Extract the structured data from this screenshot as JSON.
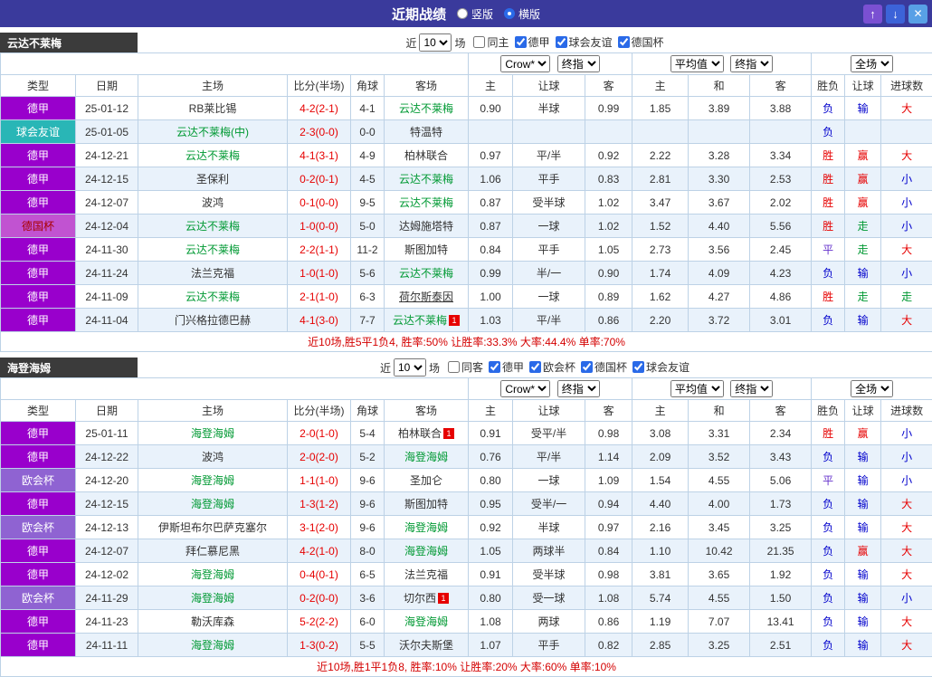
{
  "header": {
    "title": "近期战绩",
    "vertical_label": "竖版",
    "horizontal_label": "横版",
    "selected_layout": "横版",
    "up_icon": "↑",
    "down_icon": "↓",
    "close_icon": "✕"
  },
  "colors": {
    "topbar": "#3a3a9c",
    "focus_team": "#009933",
    "win": "#e60000",
    "lose": "#0000cc",
    "go": "#009933",
    "draw": "#6633cc"
  },
  "columns": [
    "类型",
    "日期",
    "主场",
    "比分(半场)",
    "角球",
    "客场",
    "主",
    "让球",
    "客",
    "主",
    "和",
    "客",
    "胜负",
    "让球",
    "进球数"
  ],
  "sections": [
    {
      "team": "云达不莱梅",
      "filters": {
        "near_label": "近",
        "count": "10",
        "games_label": "场",
        "options": [
          {
            "label": "同主",
            "checked": false
          },
          {
            "label": "德甲",
            "checked": true
          },
          {
            "label": "球会友谊",
            "checked": true
          },
          {
            "label": "德国杯",
            "checked": true
          }
        ]
      },
      "selects": {
        "asia_company": "Crow*",
        "asia_kind": "终指",
        "euro_company": "平均值",
        "euro_kind": "终指",
        "scope": "全场"
      },
      "rows": [
        {
          "type": "德甲",
          "tc": "dj",
          "date": "25-01-12",
          "home": {
            "t": "RB莱比锡"
          },
          "score": "4-2(2-1)",
          "corner": "4-1",
          "away": {
            "t": "云达不莱梅",
            "f": 1
          },
          "odds": [
            "0.90",
            "半球",
            "0.99",
            "1.85",
            "3.89",
            "3.88"
          ],
          "res": {
            "t": "负",
            "c": "b"
          },
          "hcp": {
            "t": "输",
            "c": "b"
          },
          "gl": {
            "t": "大",
            "c": "r"
          }
        },
        {
          "type": "球会友谊",
          "tc": "fr",
          "date": "25-01-05",
          "home": {
            "t": "云达不莱梅(中)",
            "f": 1
          },
          "score": "2-3(0-0)",
          "corner": "0-0",
          "away": {
            "t": "特温特"
          },
          "odds": [
            "",
            "",
            "",
            "",
            "",
            ""
          ],
          "res": {
            "t": "负",
            "c": "b"
          },
          "hcp": {
            "t": "",
            "c": "b"
          },
          "gl": {
            "t": "",
            "c": "r"
          }
        },
        {
          "type": "德甲",
          "tc": "dj",
          "date": "24-12-21",
          "home": {
            "t": "云达不莱梅",
            "f": 1
          },
          "score": "4-1(3-1)",
          "corner": "4-9",
          "away": {
            "t": "柏林联合"
          },
          "odds": [
            "0.97",
            "平/半",
            "0.92",
            "2.22",
            "3.28",
            "3.34"
          ],
          "res": {
            "t": "胜",
            "c": "r"
          },
          "hcp": {
            "t": "赢",
            "c": "r"
          },
          "gl": {
            "t": "大",
            "c": "r"
          }
        },
        {
          "type": "德甲",
          "tc": "dj",
          "date": "24-12-15",
          "home": {
            "t": "圣保利"
          },
          "score": "0-2(0-1)",
          "corner": "4-5",
          "away": {
            "t": "云达不莱梅",
            "f": 1
          },
          "odds": [
            "1.06",
            "平手",
            "0.83",
            "2.81",
            "3.30",
            "2.53"
          ],
          "res": {
            "t": "胜",
            "c": "r"
          },
          "hcp": {
            "t": "赢",
            "c": "r"
          },
          "gl": {
            "t": "小",
            "c": "b"
          }
        },
        {
          "type": "德甲",
          "tc": "dj",
          "date": "24-12-07",
          "home": {
            "t": "波鸿"
          },
          "score": "0-1(0-0)",
          "corner": "9-5",
          "away": {
            "t": "云达不莱梅",
            "f": 1
          },
          "odds": [
            "0.87",
            "受半球",
            "1.02",
            "3.47",
            "3.67",
            "2.02"
          ],
          "res": {
            "t": "胜",
            "c": "r"
          },
          "hcp": {
            "t": "赢",
            "c": "r"
          },
          "gl": {
            "t": "小",
            "c": "b"
          }
        },
        {
          "type": "德国杯",
          "tc": "dc",
          "date": "24-12-04",
          "home": {
            "t": "云达不莱梅",
            "f": 1
          },
          "score": "1-0(0-0)",
          "corner": "5-0",
          "away": {
            "t": "达姆施塔特"
          },
          "odds": [
            "0.87",
            "一球",
            "1.02",
            "1.52",
            "4.40",
            "5.56"
          ],
          "res": {
            "t": "胜",
            "c": "r"
          },
          "hcp": {
            "t": "走",
            "c": "g"
          },
          "gl": {
            "t": "小",
            "c": "b"
          }
        },
        {
          "type": "德甲",
          "tc": "dj",
          "date": "24-11-30",
          "home": {
            "t": "云达不莱梅",
            "f": 1
          },
          "score": "2-2(1-1)",
          "corner": "11-2",
          "away": {
            "t": "斯图加特"
          },
          "odds": [
            "0.84",
            "平手",
            "1.05",
            "2.73",
            "3.56",
            "2.45"
          ],
          "res": {
            "t": "平",
            "c": "p"
          },
          "hcp": {
            "t": "走",
            "c": "g"
          },
          "gl": {
            "t": "大",
            "c": "r"
          }
        },
        {
          "type": "德甲",
          "tc": "dj",
          "date": "24-11-24",
          "home": {
            "t": "法兰克福"
          },
          "score": "1-0(1-0)",
          "corner": "5-6",
          "away": {
            "t": "云达不莱梅",
            "f": 1
          },
          "odds": [
            "0.99",
            "半/一",
            "0.90",
            "1.74",
            "4.09",
            "4.23"
          ],
          "res": {
            "t": "负",
            "c": "b"
          },
          "hcp": {
            "t": "输",
            "c": "b"
          },
          "gl": {
            "t": "小",
            "c": "b"
          }
        },
        {
          "type": "德甲",
          "tc": "dj",
          "date": "24-11-09",
          "home": {
            "t": "云达不莱梅",
            "f": 1
          },
          "score": "2-1(1-0)",
          "corner": "6-3",
          "away": {
            "t": "荷尔斯泰因",
            "u": 1
          },
          "odds": [
            "1.00",
            "一球",
            "0.89",
            "1.62",
            "4.27",
            "4.86"
          ],
          "res": {
            "t": "胜",
            "c": "r"
          },
          "hcp": {
            "t": "走",
            "c": "g"
          },
          "gl": {
            "t": "走",
            "c": "g"
          }
        },
        {
          "type": "德甲",
          "tc": "dj",
          "date": "24-11-04",
          "home": {
            "t": "门兴格拉德巴赫"
          },
          "score": "4-1(3-0)",
          "corner": "7-7",
          "away": {
            "t": "云达不莱梅",
            "f": 1,
            "card": "1"
          },
          "odds": [
            "1.03",
            "平/半",
            "0.86",
            "2.20",
            "3.72",
            "3.01"
          ],
          "res": {
            "t": "负",
            "c": "b"
          },
          "hcp": {
            "t": "输",
            "c": "b"
          },
          "gl": {
            "t": "大",
            "c": "r"
          }
        }
      ],
      "summary": "近10场,胜5平1负4, 胜率:50% 让胜率:33.3% 大率:44.4% 单率:70%"
    },
    {
      "team": "海登海姆",
      "filters": {
        "near_label": "近",
        "count": "10",
        "games_label": "场",
        "options": [
          {
            "label": "同客",
            "checked": false
          },
          {
            "label": "德甲",
            "checked": true
          },
          {
            "label": "欧会杯",
            "checked": true
          },
          {
            "label": "德国杯",
            "checked": true
          },
          {
            "label": "球会友谊",
            "checked": true
          }
        ]
      },
      "selects": {
        "asia_company": "Crow*",
        "asia_kind": "终指",
        "euro_company": "平均值",
        "euro_kind": "终指",
        "scope": "全场"
      },
      "rows": [
        {
          "type": "德甲",
          "tc": "dj",
          "date": "25-01-11",
          "home": {
            "t": "海登海姆",
            "f": 1
          },
          "score": "2-0(1-0)",
          "corner": "5-4",
          "away": {
            "t": "柏林联合",
            "card": "1"
          },
          "odds": [
            "0.91",
            "受平/半",
            "0.98",
            "3.08",
            "3.31",
            "2.34"
          ],
          "res": {
            "t": "胜",
            "c": "r"
          },
          "hcp": {
            "t": "赢",
            "c": "r"
          },
          "gl": {
            "t": "小",
            "c": "b"
          }
        },
        {
          "type": "德甲",
          "tc": "dj",
          "date": "24-12-22",
          "home": {
            "t": "波鸿"
          },
          "score": "2-0(2-0)",
          "corner": "5-2",
          "away": {
            "t": "海登海姆",
            "f": 1
          },
          "odds": [
            "0.76",
            "平/半",
            "1.14",
            "2.09",
            "3.52",
            "3.43"
          ],
          "res": {
            "t": "负",
            "c": "b"
          },
          "hcp": {
            "t": "输",
            "c": "b"
          },
          "gl": {
            "t": "小",
            "c": "b"
          }
        },
        {
          "type": "欧会杯",
          "tc": "ec",
          "date": "24-12-20",
          "home": {
            "t": "海登海姆",
            "f": 1
          },
          "score": "1-1(1-0)",
          "corner": "9-6",
          "away": {
            "t": "圣加仑"
          },
          "odds": [
            "0.80",
            "一球",
            "1.09",
            "1.54",
            "4.55",
            "5.06"
          ],
          "res": {
            "t": "平",
            "c": "p"
          },
          "hcp": {
            "t": "输",
            "c": "b"
          },
          "gl": {
            "t": "小",
            "c": "b"
          }
        },
        {
          "type": "德甲",
          "tc": "dj",
          "date": "24-12-15",
          "home": {
            "t": "海登海姆",
            "f": 1
          },
          "score": "1-3(1-2)",
          "corner": "9-6",
          "away": {
            "t": "斯图加特"
          },
          "odds": [
            "0.95",
            "受半/一",
            "0.94",
            "4.40",
            "4.00",
            "1.73"
          ],
          "res": {
            "t": "负",
            "c": "b"
          },
          "hcp": {
            "t": "输",
            "c": "b"
          },
          "gl": {
            "t": "大",
            "c": "r"
          }
        },
        {
          "type": "欧会杯",
          "tc": "ec",
          "date": "24-12-13",
          "home": {
            "t": "伊斯坦布尔巴萨克塞尔"
          },
          "score": "3-1(2-0)",
          "corner": "9-6",
          "away": {
            "t": "海登海姆",
            "f": 1
          },
          "odds": [
            "0.92",
            "半球",
            "0.97",
            "2.16",
            "3.45",
            "3.25"
          ],
          "res": {
            "t": "负",
            "c": "b"
          },
          "hcp": {
            "t": "输",
            "c": "b"
          },
          "gl": {
            "t": "大",
            "c": "r"
          }
        },
        {
          "type": "德甲",
          "tc": "dj",
          "date": "24-12-07",
          "home": {
            "t": "拜仁慕尼黑"
          },
          "score": "4-2(1-0)",
          "corner": "8-0",
          "away": {
            "t": "海登海姆",
            "f": 1
          },
          "odds": [
            "1.05",
            "两球半",
            "0.84",
            "1.10",
            "10.42",
            "21.35"
          ],
          "res": {
            "t": "负",
            "c": "b"
          },
          "hcp": {
            "t": "赢",
            "c": "r"
          },
          "gl": {
            "t": "大",
            "c": "r"
          }
        },
        {
          "type": "德甲",
          "tc": "dj",
          "date": "24-12-02",
          "home": {
            "t": "海登海姆",
            "f": 1
          },
          "score": "0-4(0-1)",
          "corner": "6-5",
          "away": {
            "t": "法兰克福"
          },
          "odds": [
            "0.91",
            "受半球",
            "0.98",
            "3.81",
            "3.65",
            "1.92"
          ],
          "res": {
            "t": "负",
            "c": "b"
          },
          "hcp": {
            "t": "输",
            "c": "b"
          },
          "gl": {
            "t": "大",
            "c": "r"
          }
        },
        {
          "type": "欧会杯",
          "tc": "ec",
          "date": "24-11-29",
          "home": {
            "t": "海登海姆",
            "f": 1
          },
          "score": "0-2(0-0)",
          "corner": "3-6",
          "away": {
            "t": "切尔西",
            "card": "1"
          },
          "odds": [
            "0.80",
            "受一球",
            "1.08",
            "5.74",
            "4.55",
            "1.50"
          ],
          "res": {
            "t": "负",
            "c": "b"
          },
          "hcp": {
            "t": "输",
            "c": "b"
          },
          "gl": {
            "t": "小",
            "c": "b"
          }
        },
        {
          "type": "德甲",
          "tc": "dj",
          "date": "24-11-23",
          "home": {
            "t": "勒沃库森"
          },
          "score": "5-2(2-2)",
          "corner": "6-0",
          "away": {
            "t": "海登海姆",
            "f": 1
          },
          "odds": [
            "1.08",
            "两球",
            "0.86",
            "1.19",
            "7.07",
            "13.41"
          ],
          "res": {
            "t": "负",
            "c": "b"
          },
          "hcp": {
            "t": "输",
            "c": "b"
          },
          "gl": {
            "t": "大",
            "c": "r"
          }
        },
        {
          "type": "德甲",
          "tc": "dj",
          "date": "24-11-11",
          "home": {
            "t": "海登海姆",
            "f": 1
          },
          "score": "1-3(0-2)",
          "corner": "5-5",
          "away": {
            "t": "沃尔夫斯堡"
          },
          "odds": [
            "1.07",
            "平手",
            "0.82",
            "2.85",
            "3.25",
            "2.51"
          ],
          "res": {
            "t": "负",
            "c": "b"
          },
          "hcp": {
            "t": "输",
            "c": "b"
          },
          "gl": {
            "t": "大",
            "c": "r"
          }
        }
      ],
      "summary": "近10场,胜1平1负8, 胜率:10% 让胜率:20% 大率:60% 单率:10%"
    }
  ]
}
